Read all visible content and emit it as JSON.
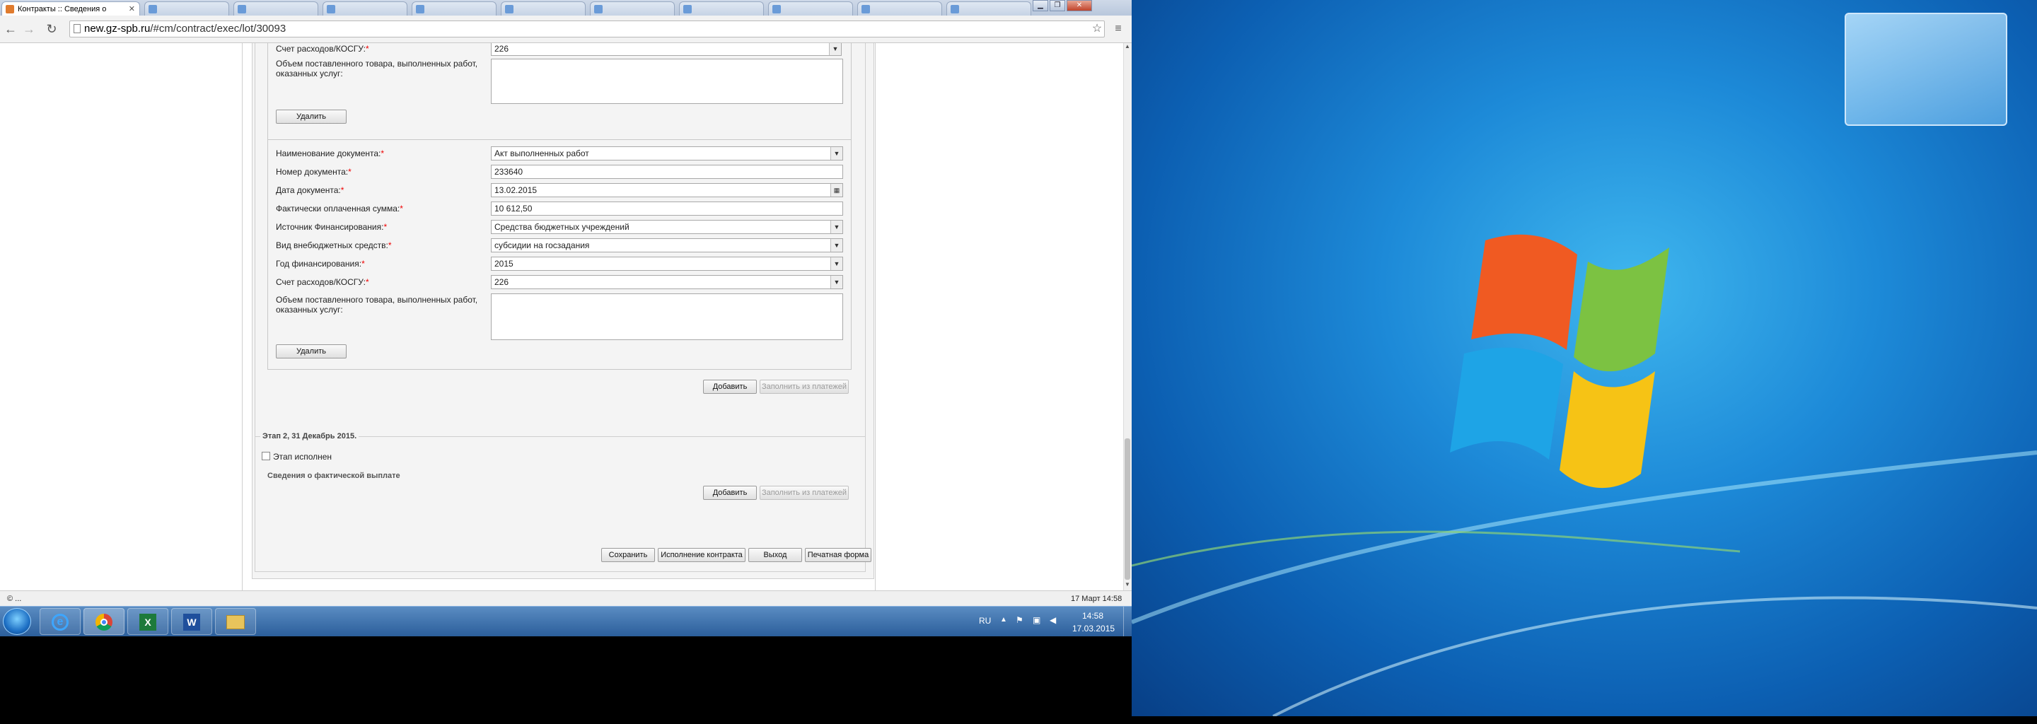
{
  "browser": {
    "tabs": [
      {
        "label": "Контракты :: Сведения о",
        "active": true
      },
      {
        "label": "",
        "active": false
      },
      {
        "label": "",
        "active": false
      },
      {
        "label": "",
        "active": false
      },
      {
        "label": "",
        "active": false
      },
      {
        "label": "",
        "active": false
      },
      {
        "label": "",
        "active": false
      },
      {
        "label": "",
        "active": false
      }
    ],
    "url_host": "new.gz-spb.ru",
    "url_path": "/#cm/contract/exec/lot/30093",
    "status_left": "© ...",
    "status_right": "17 Март 14:58"
  },
  "form": {
    "top_panel": {
      "account_label": "Счет расходов/КОСГУ:",
      "account_value": "226",
      "volume_label_line1": "Объем поставленного товара, выполненных работ,",
      "volume_label_line2": "оказанных услуг:",
      "delete_label": "Удалить"
    },
    "doc_panel": {
      "doc_name_label": "Наименование документа:",
      "doc_name_value": "Акт выполненных работ",
      "doc_number_label": "Номер документа:",
      "doc_number_value": "233640",
      "doc_date_label": "Дата документа:",
      "doc_date_value": "13.02.2015",
      "paid_sum_label": "Фактически оплаченная сумма:",
      "paid_sum_value": "10 612,50",
      "source_label": "Источник Финансирования:",
      "source_value": "Средства бюджетных учреждений",
      "offbudget_label": "Вид внебюджетных средств:",
      "offbudget_value": "субсидии на госзадания",
      "year_label": "Год финансирования:",
      "year_value": "2015",
      "account_label": "Счет расходов/КОСГУ:",
      "account_value": "226",
      "volume_label_line1": "Объем поставленного товара, выполненных работ,",
      "volume_label_line2": "оказанных услуг:",
      "delete_label": "Удалить"
    },
    "add_label": "Добавить",
    "fill_from_payments_label": "Заполнить из платежей",
    "stage2": {
      "legend": "Этап 2, 31 Декабрь 2015.",
      "done_label": "Этап исполнен",
      "actual_payment_heading": "Сведения о фактической выплате",
      "add_label": "Добавить",
      "fill_from_payments_label": "Заполнить из платежей"
    },
    "footer_buttons": {
      "save": "Сохранить",
      "execution": "Исполнение контракта",
      "exit": "Выход",
      "print": "Печатная форма"
    },
    "required_marker": "*"
  },
  "taskbar": {
    "language": "RU",
    "time": "14:58",
    "date": "17.03.2015",
    "pinned_icons": [
      "internet-explorer-icon",
      "chrome-icon",
      "excel-icon",
      "word-icon",
      "explorer-folder-icon"
    ]
  },
  "colors": {
    "required": "#e00000",
    "taskbar": "#2a5d9a",
    "desktop": "#1d8ad8"
  }
}
